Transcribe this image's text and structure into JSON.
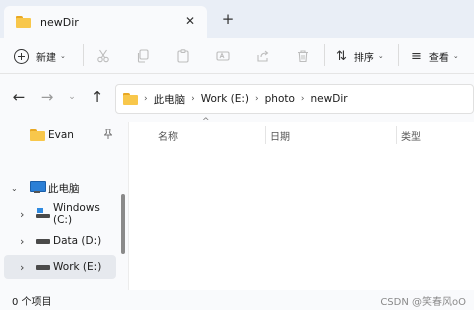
{
  "window": {
    "tab_title": "newDir",
    "close_glyph": "✕",
    "new_tab_glyph": "+"
  },
  "toolbar": {
    "new_label": "新建",
    "sort_label": "排序",
    "view_label": "查看",
    "chevron": "⌄",
    "icons": [
      "cut-icon",
      "copy-icon",
      "paste-icon",
      "rename-icon",
      "share-icon",
      "delete-icon"
    ],
    "sort_glyph": "⇅",
    "view_glyph": "≡"
  },
  "nav": {
    "back": "←",
    "forward": "→",
    "recent": "⌄",
    "up": "↑"
  },
  "address": {
    "crumbs": [
      "此电脑",
      "Work (E:)",
      "photo",
      "newDir"
    ],
    "separator": "›"
  },
  "sidebar": {
    "items": [
      {
        "label": "Evan",
        "icon": "folder-icon",
        "pinned": true
      },
      {
        "label": "此电脑",
        "icon": "pc-icon",
        "expanded": true
      },
      {
        "label": "Windows (C:)",
        "icon": "windows-drive-icon"
      },
      {
        "label": "Data (D:)",
        "icon": "drive-icon"
      },
      {
        "label": "Work (E:)",
        "icon": "drive-icon",
        "selected": true
      }
    ],
    "pin_glyph": "📌",
    "expand_glyph": "›",
    "expanded_glyph": "⌄"
  },
  "content": {
    "columns": [
      "名称",
      "日期",
      "类型"
    ],
    "sort_caret": "^"
  },
  "status": {
    "count_text": "0 个项目",
    "watermark": "CSDN @笑春风oO"
  },
  "colors": {
    "accent": "#2b7fd6",
    "folder": "#f8c74b",
    "titlebar": "#e9eef6"
  }
}
